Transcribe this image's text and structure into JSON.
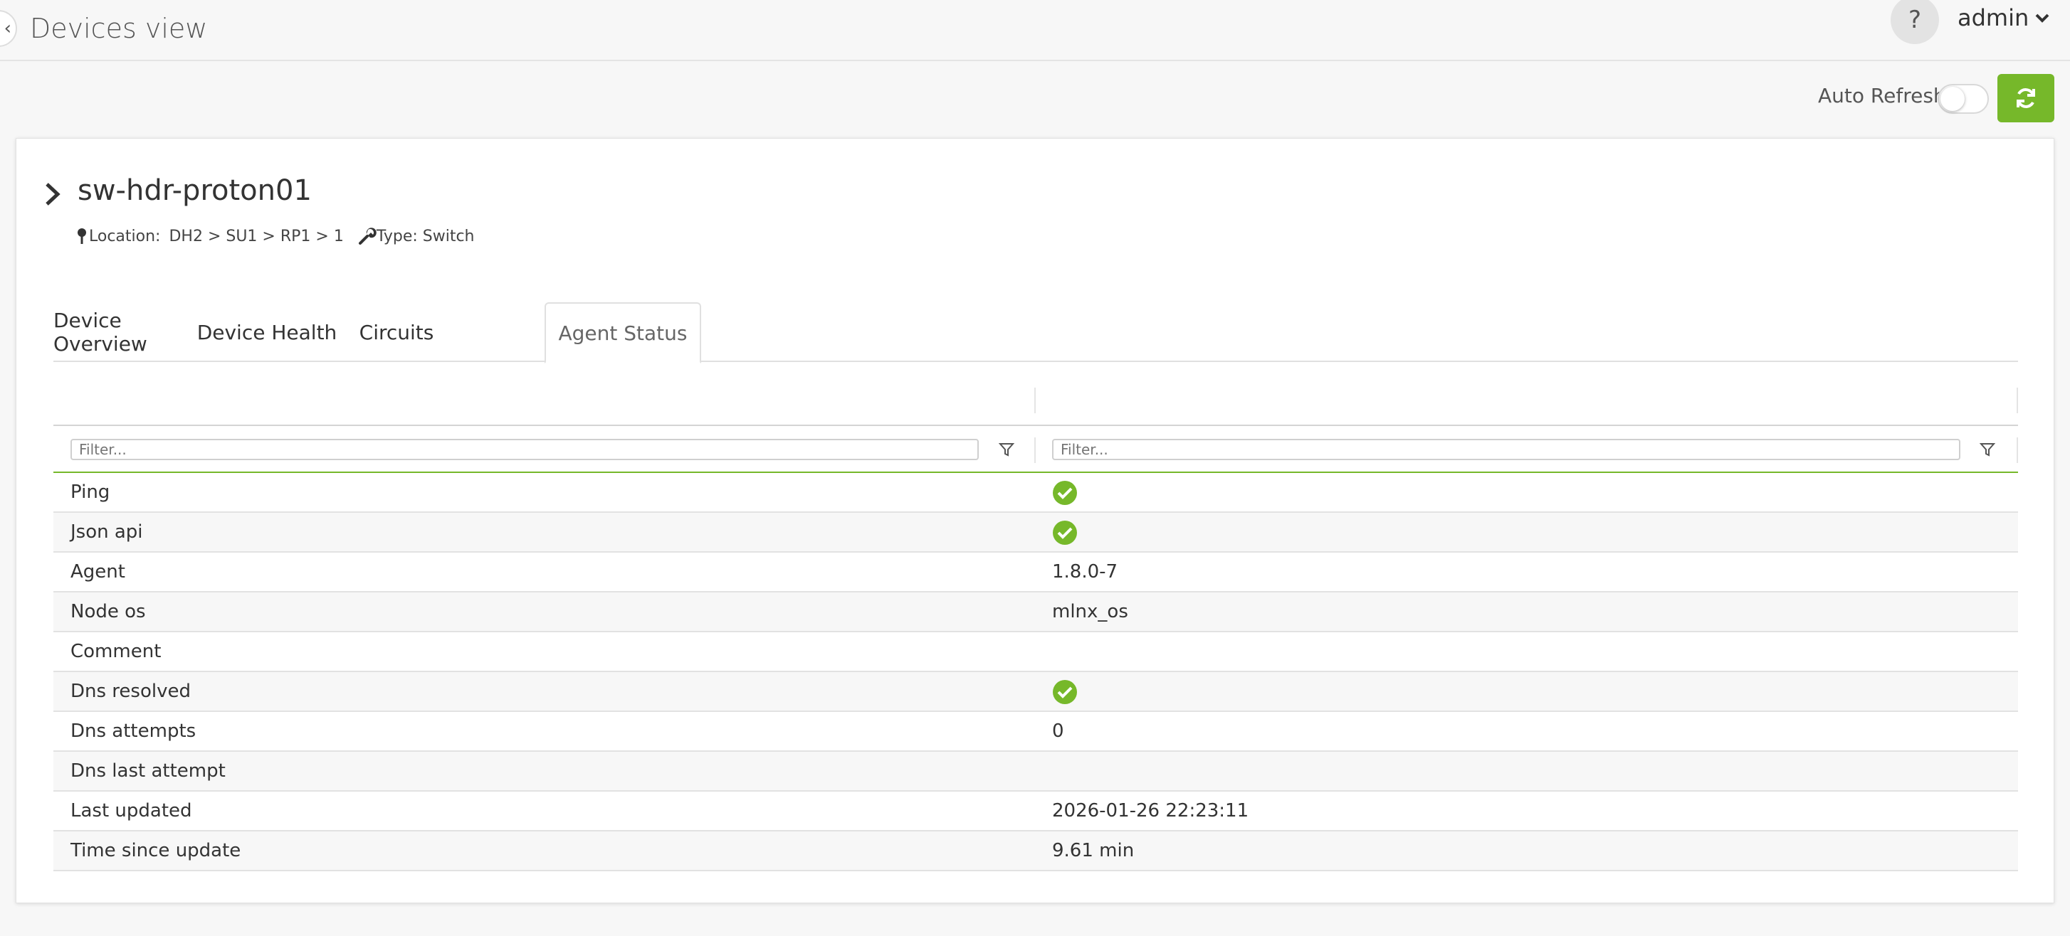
{
  "header": {
    "title": "Devices view",
    "help_label": "?",
    "user_name": "admin"
  },
  "toolbar": {
    "auto_refresh_label": "Auto Refresh",
    "auto_refresh_on": false,
    "accent_color": "#76b82a"
  },
  "device": {
    "name": "sw-hdr-proton01",
    "location_label": "Location:",
    "location_value": "DH2 > SU1 > RP1 > 1",
    "type_text": "Type: Switch"
  },
  "tabs": [
    {
      "label": "Device Overview",
      "active": false
    },
    {
      "label": "Device Health",
      "active": false
    },
    {
      "label": "Circuits",
      "active": false
    },
    {
      "label": "Agent Status",
      "active": true
    }
  ],
  "table": {
    "filter_placeholder": "Filter...",
    "rows": [
      {
        "name": "Ping",
        "value": "",
        "status_icon": "check-circle-icon"
      },
      {
        "name": "Json api",
        "value": "",
        "status_icon": "check-circle-icon"
      },
      {
        "name": "Agent",
        "value": "1.8.0-7"
      },
      {
        "name": "Node os",
        "value": "mlnx_os"
      },
      {
        "name": "Comment",
        "value": ""
      },
      {
        "name": "Dns resolved",
        "value": "",
        "status_icon": "check-circle-icon"
      },
      {
        "name": "Dns attempts",
        "value": "0"
      },
      {
        "name": "Dns last attempt",
        "value": ""
      },
      {
        "name": "Last updated",
        "value": "2026-01-26 22:23:11"
      },
      {
        "name": "Time since update",
        "value": "9.61 min"
      }
    ]
  }
}
